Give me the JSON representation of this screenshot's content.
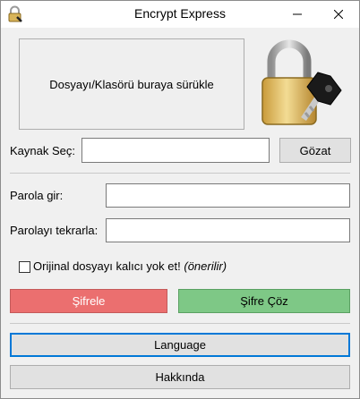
{
  "window": {
    "title": "Encrypt Express",
    "icon": "padlock-icon"
  },
  "drop_zone": {
    "text": "Dosyayı/Klasörü buraya sürükle"
  },
  "source": {
    "label": "Kaynak Seç:",
    "value": "",
    "browse_label": "Gözat"
  },
  "password": {
    "label": "Parola gir:",
    "value": ""
  },
  "password_repeat": {
    "label": "Parolayı tekrarla:",
    "value": ""
  },
  "delete_original": {
    "label": "Orijinal dosyayı kalıcı yok et!",
    "hint": "(önerilir)",
    "checked": false
  },
  "actions": {
    "encrypt_label": "Şifrele",
    "decrypt_label": "Şifre Çöz",
    "encrypt_color": "#eb6f6f",
    "decrypt_color": "#7ec886"
  },
  "footer": {
    "language_label": "Language",
    "about_label": "Hakkında"
  }
}
